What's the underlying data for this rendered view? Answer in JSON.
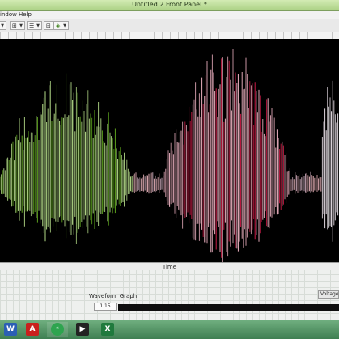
{
  "window": {
    "title": "Untitled 2 Front Panel *"
  },
  "menu": {
    "items": [
      "indow",
      "Help"
    ]
  },
  "toolbar": {
    "buttons": [
      {
        "name": "font-size",
        "icon": "font-size-icon"
      },
      {
        "name": "align-objects",
        "icon": "align-objects-icon"
      },
      {
        "name": "distribute-objects",
        "icon": "distribute-objects-icon"
      },
      {
        "name": "resize-objects",
        "icon": "resize-objects-icon"
      },
      {
        "name": "reorder",
        "icon": "reorder-icon"
      }
    ]
  },
  "graph": {
    "background": "#000000",
    "xlabel": "Time",
    "legend_label": "Waveform Graph",
    "plot_name": "Voltage",
    "scale_value": "1.15",
    "segments": [
      {
        "start": 0.0,
        "end": 0.39,
        "peak": 0.72,
        "rest": 0.08,
        "color": "#bfe890",
        "accent": "#5fa61e"
      },
      {
        "start": 0.39,
        "end": 0.48,
        "peak": 0.1,
        "rest": 0.08,
        "color": "#f0b8c0",
        "accent": "#c9a8b8"
      },
      {
        "start": 0.48,
        "end": 0.86,
        "peak": 0.9,
        "rest": 0.08,
        "color": "#f6b8c8",
        "accent": "#d11c48"
      },
      {
        "start": 0.86,
        "end": 0.95,
        "peak": 0.1,
        "rest": 0.08,
        "color": "#f0b8c0",
        "accent": "#c9a8b8"
      },
      {
        "start": 0.95,
        "end": 1.0,
        "peak": 0.75,
        "rest": 0.5,
        "color": "#f1e7ef",
        "accent": "#f7f7f7"
      }
    ]
  },
  "taskbar": {
    "items": [
      {
        "name": "word",
        "icon": "word-icon",
        "glyph": "W",
        "color": "#2b5fb4"
      },
      {
        "name": "acrobat",
        "icon": "acrobat-icon",
        "glyph": "A",
        "color": "#c8201d"
      },
      {
        "name": "hangouts",
        "icon": "hangouts-icon",
        "glyph": "❝",
        "color": "#2ea44f"
      },
      {
        "name": "media",
        "icon": "media-icon",
        "glyph": "▶",
        "color": "#222222"
      },
      {
        "name": "excel",
        "icon": "excel-icon",
        "glyph": "X",
        "color": "#1f7a3d"
      }
    ]
  }
}
